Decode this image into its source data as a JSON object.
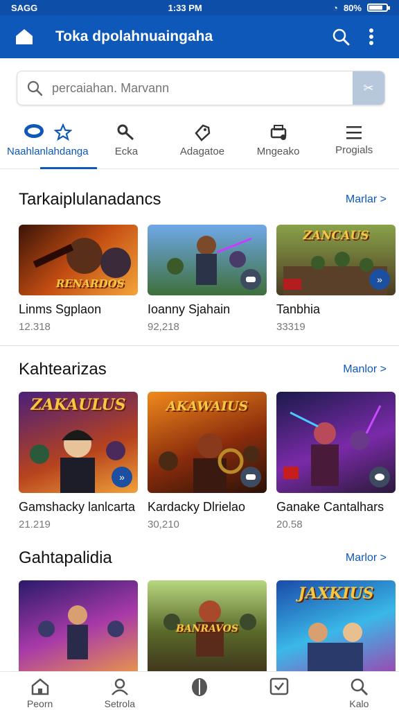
{
  "status": {
    "carrier": "SAGG",
    "time": "1:33 PM",
    "battery": "80%",
    "battery_level": 0.8
  },
  "appbar": {
    "title": "Toka dpolahnuaingaha"
  },
  "search": {
    "placeholder": "percaiahan. Marvann"
  },
  "tabs": [
    {
      "label": "Naahlanlahdanga",
      "icon": "star-icon",
      "active": true
    },
    {
      "label": "Ecka",
      "icon": "key-icon"
    },
    {
      "label": "Adagatoe",
      "icon": "tag-icon"
    },
    {
      "label": "Mngeako",
      "icon": "printer-icon"
    },
    {
      "label": "Progials",
      "icon": "menu-icon"
    }
  ],
  "sections": [
    {
      "title": "Tarkaiplulanadancs",
      "more": "Marlar >",
      "cards": [
        {
          "name": "Linms Sgplaon",
          "count": "12.318",
          "logo": "RENARDOS"
        },
        {
          "name": "Ioanny Sjahain",
          "count": "92,218",
          "logo": ""
        },
        {
          "name": "Tanbhia",
          "count": "33319",
          "logo": "ZANCAUS"
        }
      ]
    },
    {
      "title": "Kahtearizas",
      "more": "Manlor >",
      "cards": [
        {
          "name": "Gamshacky lanlcarta",
          "count": "21.219",
          "logo": "ZAKAULUS"
        },
        {
          "name": "Kardacky Dlrielao",
          "count": "30,210",
          "logo": "AKAWAIUS"
        },
        {
          "name": "Ganake Cantalhars",
          "count": "20.58",
          "logo": ""
        }
      ]
    },
    {
      "title": "Gahtapalidia",
      "more": "Marlor >",
      "cards": [
        {
          "name": "",
          "count": "",
          "logo": ""
        },
        {
          "name": "",
          "count": "",
          "logo": "BANRAVOS"
        },
        {
          "name": "",
          "count": "",
          "logo": "JAXKIUS"
        }
      ]
    }
  ],
  "bottomnav": [
    {
      "label": "Peorn",
      "icon": "home-icon"
    },
    {
      "label": "Setrola",
      "icon": "person-icon"
    },
    {
      "label": "",
      "icon": "coin-icon"
    },
    {
      "label": "",
      "icon": "check-icon"
    },
    {
      "label": "Kalo",
      "icon": "search-icon"
    }
  ],
  "colors": {
    "primary": "#0d58b8",
    "statusbar": "#0d4fa8"
  }
}
